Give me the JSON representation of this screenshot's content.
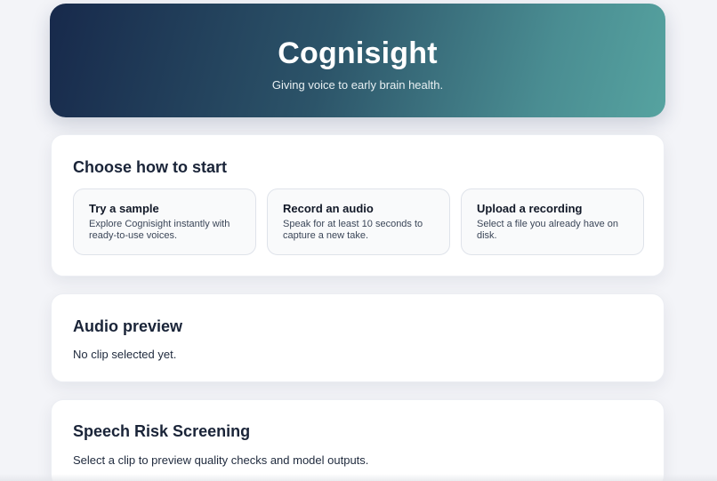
{
  "hero": {
    "title": "Cognisight",
    "tagline": "Giving voice to early brain health."
  },
  "start": {
    "heading": "Choose how to start",
    "options": [
      {
        "title": "Try a sample",
        "description": "Explore Cognisight instantly with ready-to-use voices."
      },
      {
        "title": "Record an audio",
        "description": "Speak for at least 10 seconds to capture a new take."
      },
      {
        "title": "Upload a recording",
        "description": "Select a file you already have on disk."
      }
    ]
  },
  "preview": {
    "heading": "Audio preview",
    "status": "No clip selected yet."
  },
  "risk": {
    "heading": "Speech Risk Screening",
    "status": "Select a clip to preview quality checks and model outputs."
  },
  "colors": {
    "hero_start": "#17294b",
    "hero_end": "#56a3a0",
    "page_background": "#f3f4f8"
  }
}
